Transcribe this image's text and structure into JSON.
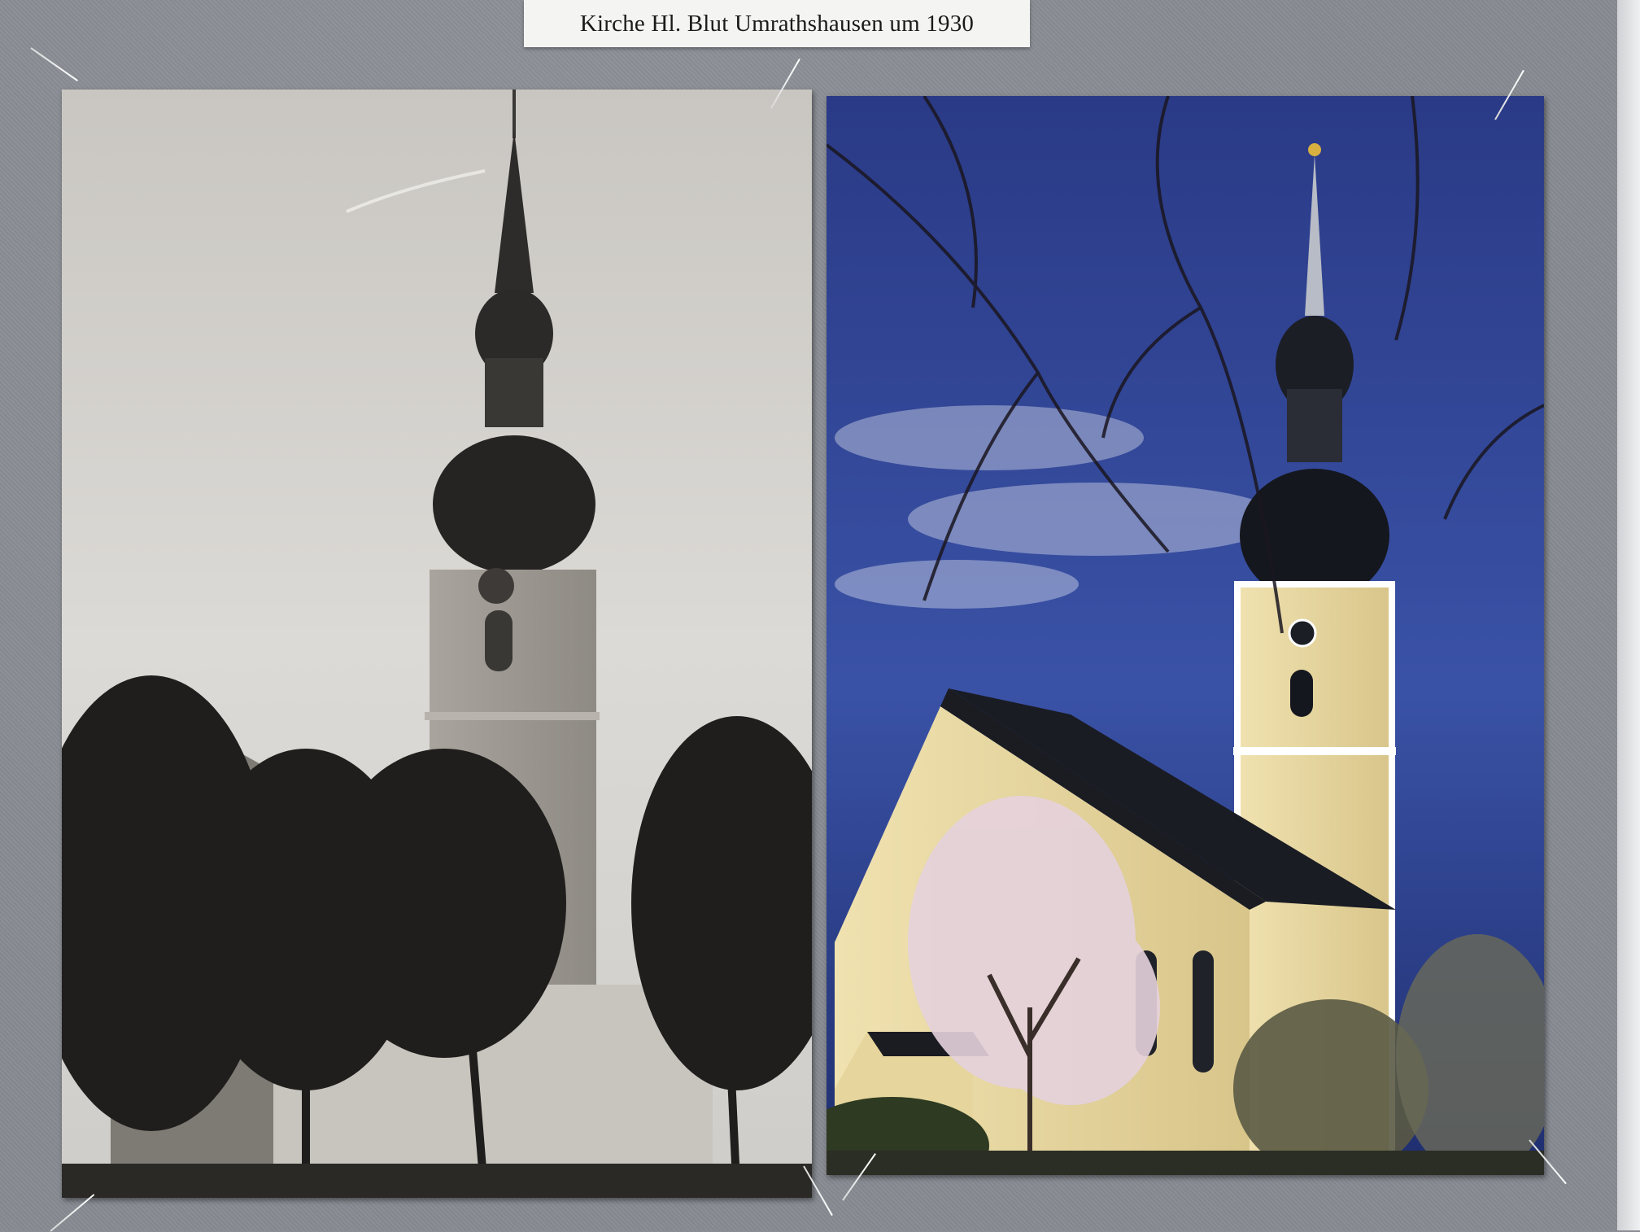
{
  "caption": "Kirche Hl. Blut Umrathshausen um 1930",
  "photos": [
    {
      "name": "historic-church-photo",
      "style": "black-and-white"
    },
    {
      "name": "modern-church-photo",
      "style": "color"
    }
  ],
  "colors": {
    "board": "#878b92",
    "old_sky": "#d7d4cf",
    "new_sky": "#2c3f8c",
    "facade": "#ead9a0"
  }
}
